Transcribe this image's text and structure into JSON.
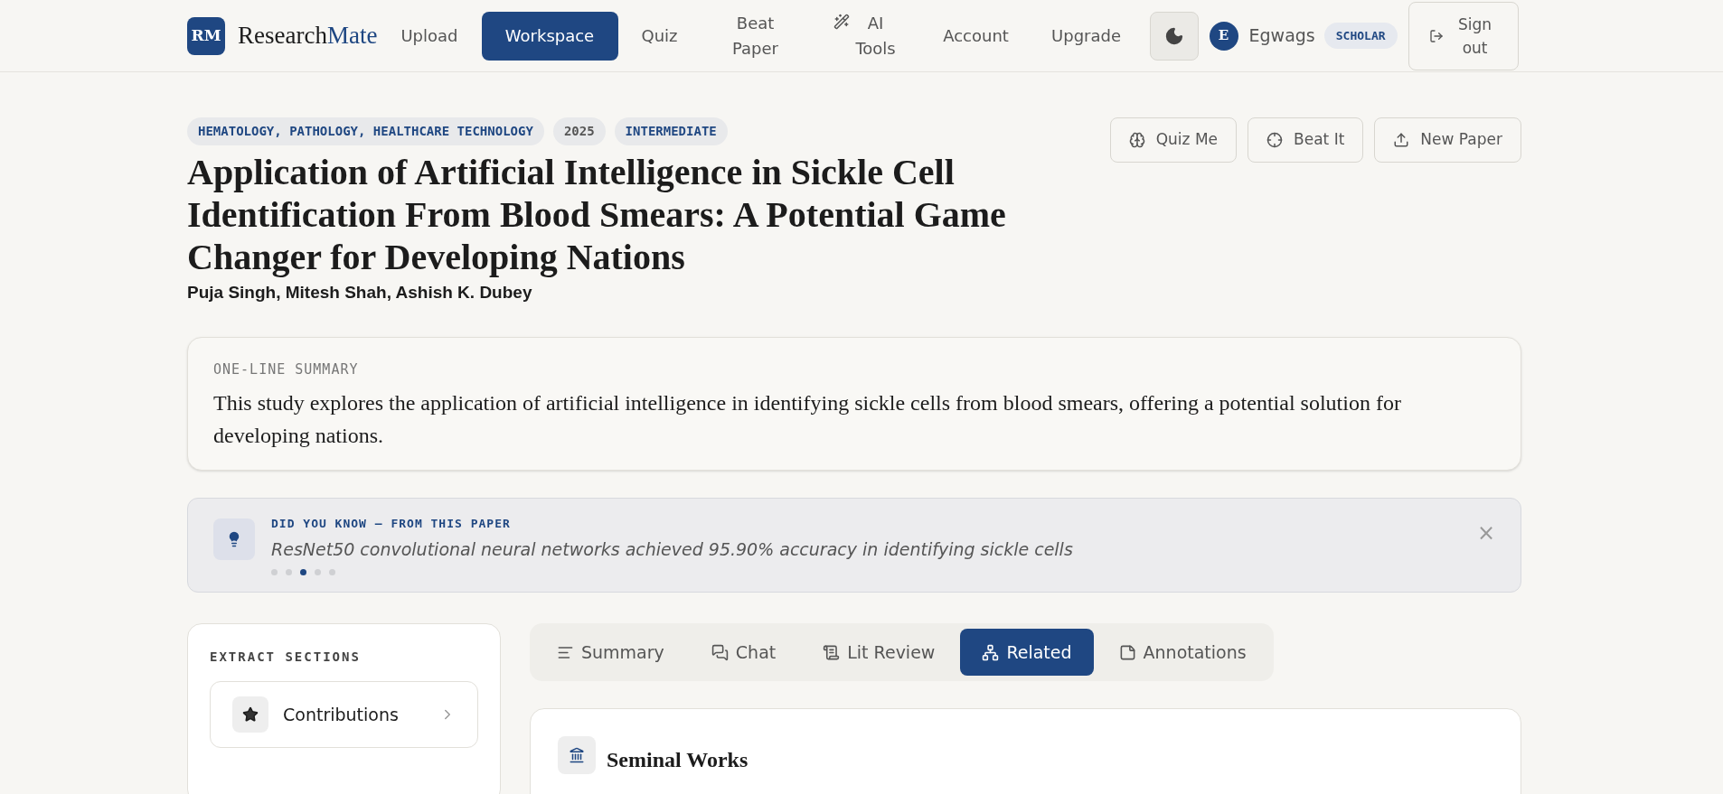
{
  "brand": {
    "logo": "RM",
    "name_start": "Research",
    "name_end": "Mate"
  },
  "nav": [
    {
      "label": "Upload",
      "selected": false
    },
    {
      "label": "Workspace",
      "selected": true
    },
    {
      "label": "Quiz",
      "selected": false
    },
    {
      "label": "Beat Paper",
      "selected": false
    },
    {
      "label": "AI Tools",
      "selected": false
    },
    {
      "label": "Account",
      "selected": false
    },
    {
      "label": "Upgrade",
      "selected": false
    }
  ],
  "user": {
    "initial": "E",
    "name": "Egwags",
    "plan": "SCHOLAR"
  },
  "sign_out": "Sign out",
  "tags": [
    "HEMATOLOGY, PATHOLOGY, HEALTHCARE TECHNOLOGY",
    "2025",
    "INTERMEDIATE"
  ],
  "actions": [
    {
      "label": "Quiz Me"
    },
    {
      "label": "Beat It"
    },
    {
      "label": "New Paper"
    }
  ],
  "title": "Application of Artificial Intelligence in Sickle Cell Identification From Blood Smears: A Potential Game Changer for Developing Nations",
  "authors": "Puja Singh, Mitesh Shah, Ashish K. Dubey",
  "summary": {
    "label": "ONE-LINE SUMMARY",
    "text": "This study explores the application of artificial intelligence in identifying sickle cells from blood smears, offering a potential solution for developing nations."
  },
  "did_you_know": {
    "label": "DID YOU KNOW — FROM THIS PAPER",
    "text": "ResNet50 convolutional neural networks achieved 95.90% accuracy in identifying sickle cells",
    "close": "×",
    "dots": [
      {
        "selected": false
      },
      {
        "selected": false
      },
      {
        "selected": true
      },
      {
        "selected": false
      },
      {
        "selected": false
      }
    ]
  },
  "sidebar": {
    "title": "EXTRACT SECTIONS",
    "items": [
      {
        "label": "Contributions"
      }
    ]
  },
  "tabs": [
    {
      "label": "Summary",
      "selected": false
    },
    {
      "label": "Chat",
      "selected": false
    },
    {
      "label": "Lit Review",
      "selected": false
    },
    {
      "label": "Related",
      "selected": true
    },
    {
      "label": "Annotations",
      "selected": false
    }
  ],
  "panel": {
    "title": "Seminal Works"
  }
}
